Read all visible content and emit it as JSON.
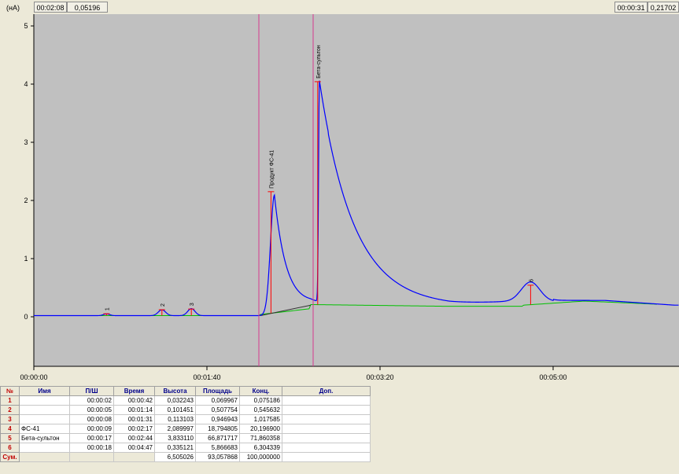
{
  "cursor": {
    "time": "00:02:08",
    "value": "0,05196"
  },
  "right_cursor": {
    "time": "00:00:31",
    "value": "0,21702"
  },
  "axis": {
    "y_unit": "(нА)",
    "y_ticks": [
      "5",
      "4",
      "3",
      "2",
      "1",
      "0"
    ],
    "x_ticks": [
      "00:00:00",
      "00:01:40",
      "00:03:20",
      "00:05:00"
    ]
  },
  "colors": {
    "plot_bg": "#c0c0c0",
    "signal": "#0000ff",
    "baseline": "#00c000",
    "marker": "#ff0000",
    "cursor_line": "#d63a8e",
    "index": "#c00000",
    "header": "#00008b"
  },
  "peaks": [
    {
      "label": "1",
      "time_s": 42,
      "height": 0.032243
    },
    {
      "label": "2",
      "time_s": 74,
      "height": 0.101451
    },
    {
      "label": "3",
      "time_s": 91,
      "height": 0.113103
    },
    {
      "label": "Продукт ФС-41",
      "time_s": 137,
      "height": 2.089997
    },
    {
      "label": "Бета-сультон",
      "time_s": 164,
      "height": 3.83311
    },
    {
      "label": "6",
      "time_s": 287,
      "height": 0.335121
    }
  ],
  "table": {
    "headers": [
      "№",
      "Имя",
      "П/Ш",
      "Время",
      "Высота",
      "Площадь",
      "Конц.",
      "Доп."
    ],
    "rows": [
      [
        "1",
        "",
        "00:00:02",
        "00:00:42",
        "0,032243",
        "0,069967",
        "0,075186",
        ""
      ],
      [
        "2",
        "",
        "00:00:05",
        "00:01:14",
        "0,101451",
        "0,507754",
        "0,545632",
        ""
      ],
      [
        "3",
        "",
        "00:00:08",
        "00:01:31",
        "0,113103",
        "0,946943",
        "1,017585",
        ""
      ],
      [
        "4",
        "ФС-41",
        "00:00:09",
        "00:02:17",
        "2,089997",
        "18,794805",
        "20,196900",
        ""
      ],
      [
        "5",
        "Бета-сультон",
        "00:00:17",
        "00:02:44",
        "3,833110",
        "66,871717",
        "71,860358",
        ""
      ],
      [
        "6",
        "",
        "00:00:18",
        "00:04:47",
        "0,335121",
        "5,866683",
        "6,304339",
        ""
      ]
    ],
    "sum_row": [
      "Сум.",
      "",
      "",
      "",
      "6,505026",
      "93,057868",
      "100,000000",
      ""
    ]
  }
}
